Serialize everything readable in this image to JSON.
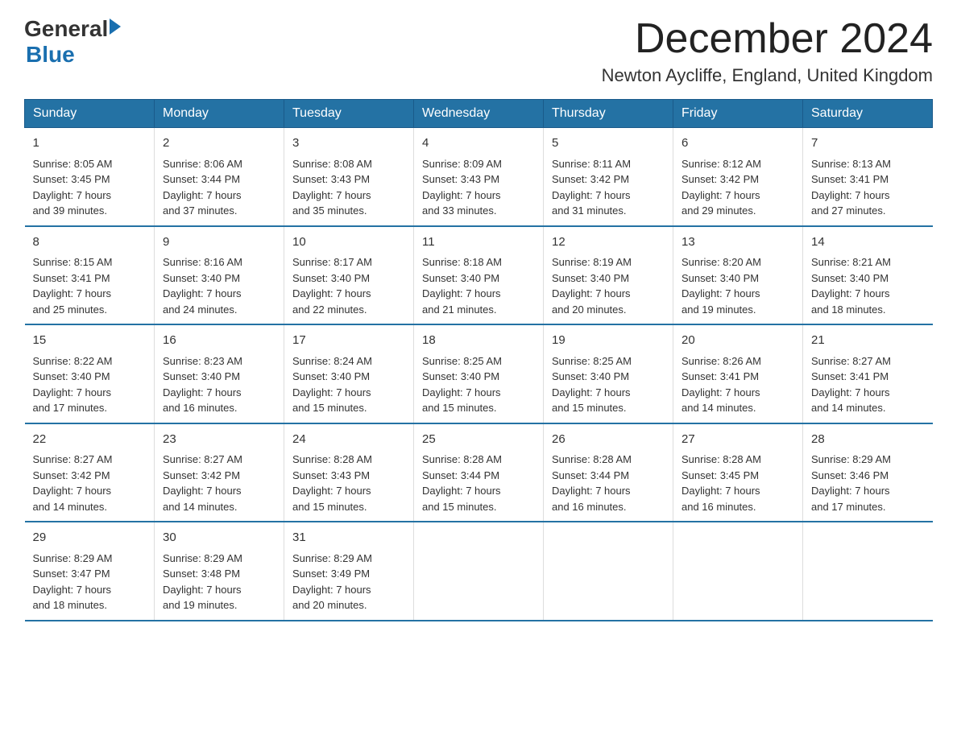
{
  "logo": {
    "general": "General",
    "arrow": "▶",
    "blue": "Blue"
  },
  "title": "December 2024",
  "location": "Newton Aycliffe, England, United Kingdom",
  "weekdays": [
    "Sunday",
    "Monday",
    "Tuesday",
    "Wednesday",
    "Thursday",
    "Friday",
    "Saturday"
  ],
  "weeks": [
    [
      {
        "day": "1",
        "sunrise": "8:05 AM",
        "sunset": "3:45 PM",
        "daylight": "7 hours and 39 minutes."
      },
      {
        "day": "2",
        "sunrise": "8:06 AM",
        "sunset": "3:44 PM",
        "daylight": "7 hours and 37 minutes."
      },
      {
        "day": "3",
        "sunrise": "8:08 AM",
        "sunset": "3:43 PM",
        "daylight": "7 hours and 35 minutes."
      },
      {
        "day": "4",
        "sunrise": "8:09 AM",
        "sunset": "3:43 PM",
        "daylight": "7 hours and 33 minutes."
      },
      {
        "day": "5",
        "sunrise": "8:11 AM",
        "sunset": "3:42 PM",
        "daylight": "7 hours and 31 minutes."
      },
      {
        "day": "6",
        "sunrise": "8:12 AM",
        "sunset": "3:42 PM",
        "daylight": "7 hours and 29 minutes."
      },
      {
        "day": "7",
        "sunrise": "8:13 AM",
        "sunset": "3:41 PM",
        "daylight": "7 hours and 27 minutes."
      }
    ],
    [
      {
        "day": "8",
        "sunrise": "8:15 AM",
        "sunset": "3:41 PM",
        "daylight": "7 hours and 25 minutes."
      },
      {
        "day": "9",
        "sunrise": "8:16 AM",
        "sunset": "3:40 PM",
        "daylight": "7 hours and 24 minutes."
      },
      {
        "day": "10",
        "sunrise": "8:17 AM",
        "sunset": "3:40 PM",
        "daylight": "7 hours and 22 minutes."
      },
      {
        "day": "11",
        "sunrise": "8:18 AM",
        "sunset": "3:40 PM",
        "daylight": "7 hours and 21 minutes."
      },
      {
        "day": "12",
        "sunrise": "8:19 AM",
        "sunset": "3:40 PM",
        "daylight": "7 hours and 20 minutes."
      },
      {
        "day": "13",
        "sunrise": "8:20 AM",
        "sunset": "3:40 PM",
        "daylight": "7 hours and 19 minutes."
      },
      {
        "day": "14",
        "sunrise": "8:21 AM",
        "sunset": "3:40 PM",
        "daylight": "7 hours and 18 minutes."
      }
    ],
    [
      {
        "day": "15",
        "sunrise": "8:22 AM",
        "sunset": "3:40 PM",
        "daylight": "7 hours and 17 minutes."
      },
      {
        "day": "16",
        "sunrise": "8:23 AM",
        "sunset": "3:40 PM",
        "daylight": "7 hours and 16 minutes."
      },
      {
        "day": "17",
        "sunrise": "8:24 AM",
        "sunset": "3:40 PM",
        "daylight": "7 hours and 15 minutes."
      },
      {
        "day": "18",
        "sunrise": "8:25 AM",
        "sunset": "3:40 PM",
        "daylight": "7 hours and 15 minutes."
      },
      {
        "day": "19",
        "sunrise": "8:25 AM",
        "sunset": "3:40 PM",
        "daylight": "7 hours and 15 minutes."
      },
      {
        "day": "20",
        "sunrise": "8:26 AM",
        "sunset": "3:41 PM",
        "daylight": "7 hours and 14 minutes."
      },
      {
        "day": "21",
        "sunrise": "8:27 AM",
        "sunset": "3:41 PM",
        "daylight": "7 hours and 14 minutes."
      }
    ],
    [
      {
        "day": "22",
        "sunrise": "8:27 AM",
        "sunset": "3:42 PM",
        "daylight": "7 hours and 14 minutes."
      },
      {
        "day": "23",
        "sunrise": "8:27 AM",
        "sunset": "3:42 PM",
        "daylight": "7 hours and 14 minutes."
      },
      {
        "day": "24",
        "sunrise": "8:28 AM",
        "sunset": "3:43 PM",
        "daylight": "7 hours and 15 minutes."
      },
      {
        "day": "25",
        "sunrise": "8:28 AM",
        "sunset": "3:44 PM",
        "daylight": "7 hours and 15 minutes."
      },
      {
        "day": "26",
        "sunrise": "8:28 AM",
        "sunset": "3:44 PM",
        "daylight": "7 hours and 16 minutes."
      },
      {
        "day": "27",
        "sunrise": "8:28 AM",
        "sunset": "3:45 PM",
        "daylight": "7 hours and 16 minutes."
      },
      {
        "day": "28",
        "sunrise": "8:29 AM",
        "sunset": "3:46 PM",
        "daylight": "7 hours and 17 minutes."
      }
    ],
    [
      {
        "day": "29",
        "sunrise": "8:29 AM",
        "sunset": "3:47 PM",
        "daylight": "7 hours and 18 minutes."
      },
      {
        "day": "30",
        "sunrise": "8:29 AM",
        "sunset": "3:48 PM",
        "daylight": "7 hours and 19 minutes."
      },
      {
        "day": "31",
        "sunrise": "8:29 AM",
        "sunset": "3:49 PM",
        "daylight": "7 hours and 20 minutes."
      },
      null,
      null,
      null,
      null
    ]
  ],
  "labels": {
    "sunrise": "Sunrise:",
    "sunset": "Sunset:",
    "daylight": "Daylight:"
  }
}
